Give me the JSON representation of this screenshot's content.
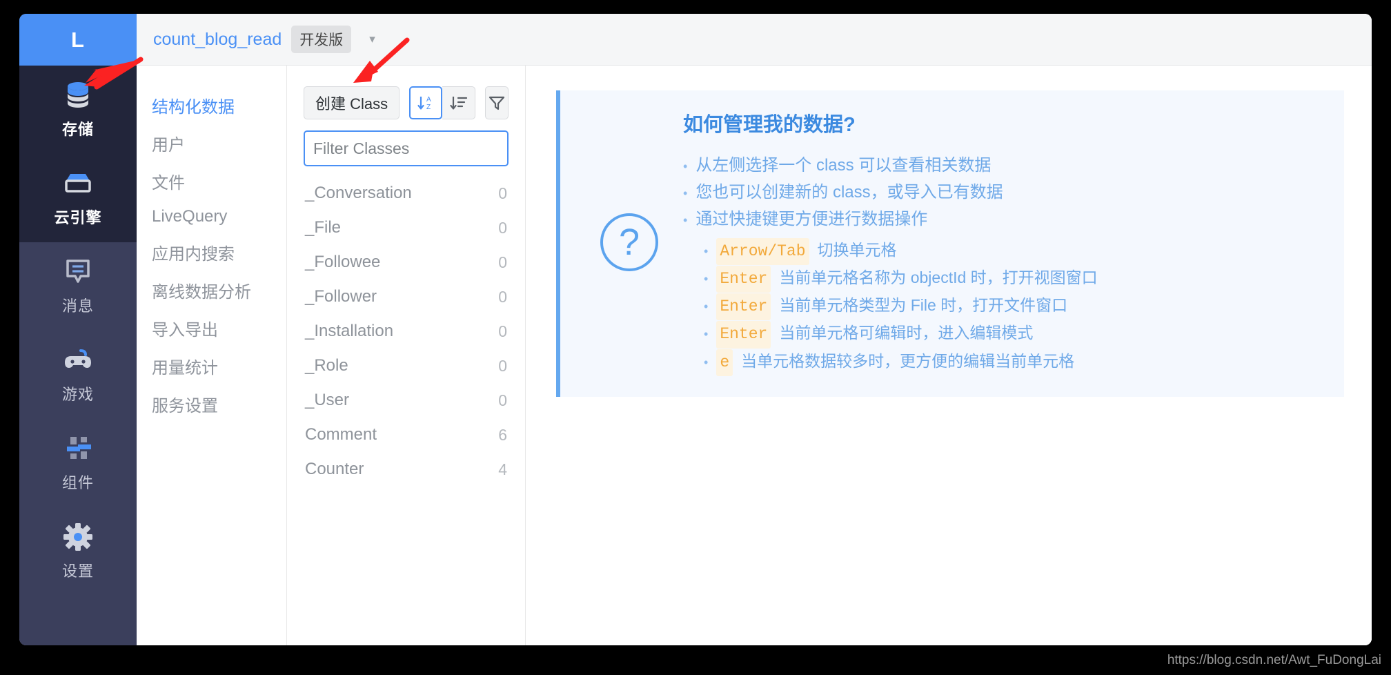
{
  "colors": {
    "accent": "#4a90f5",
    "rail_bg": "#3b3f5c",
    "rail_active_bg": "#22253a",
    "help_bg": "#f4f8fe",
    "help_text": "#6fa9e8",
    "kbd": "#f2a93b",
    "annotation": "#fb2222"
  },
  "rail": {
    "logo": "L",
    "items": [
      {
        "label": "存储",
        "icon": "database-icon",
        "active": true
      },
      {
        "label": "云引擎",
        "icon": "cloud-engine-icon",
        "active": true
      },
      {
        "label": "消息",
        "icon": "message-icon",
        "active": false
      },
      {
        "label": "游戏",
        "icon": "gamepad-icon",
        "active": false
      },
      {
        "label": "组件",
        "icon": "components-icon",
        "active": false
      },
      {
        "label": "设置",
        "icon": "gear-icon",
        "active": false
      }
    ]
  },
  "topbar": {
    "app_name": "count_blog_read",
    "env_badge": "开发版",
    "caret": "▾"
  },
  "subnav": {
    "items": [
      {
        "label": "结构化数据",
        "active": true
      },
      {
        "label": "用户",
        "active": false
      },
      {
        "label": "文件",
        "active": false
      },
      {
        "label": "LiveQuery",
        "active": false
      },
      {
        "label": "应用内搜索",
        "active": false
      },
      {
        "label": "离线数据分析",
        "active": false
      },
      {
        "label": "导入导出",
        "active": false
      },
      {
        "label": "用量统计",
        "active": false
      },
      {
        "label": "服务设置",
        "active": false
      }
    ]
  },
  "classpanel": {
    "create_button": "创建 Class",
    "sort_alpha_title": "按字母排序",
    "sort_list_title": "按顺序排序",
    "filter_title": "筛选",
    "filter_placeholder": "Filter Classes",
    "filter_value": "",
    "classes": [
      {
        "name": "_Conversation",
        "count": "0"
      },
      {
        "name": "_File",
        "count": "0"
      },
      {
        "name": "_Followee",
        "count": "0"
      },
      {
        "name": "_Follower",
        "count": "0"
      },
      {
        "name": "_Installation",
        "count": "0"
      },
      {
        "name": "_Role",
        "count": "0"
      },
      {
        "name": "_User",
        "count": "0"
      },
      {
        "name": "Comment",
        "count": "6"
      },
      {
        "name": "Counter",
        "count": "4"
      }
    ]
  },
  "help": {
    "icon": "question-mark-icon",
    "title": "如何管理我的数据?",
    "bullets": [
      "从左侧选择一个 class 可以查看相关数据",
      "您也可以创建新的 class，或导入已有数据",
      "通过快捷键更方便进行数据操作"
    ],
    "shortcuts": [
      {
        "key": "Arrow/Tab",
        "desc": "切换单元格"
      },
      {
        "key": "Enter",
        "desc": "当前单元格名称为 objectId 时，打开视图窗口"
      },
      {
        "key": "Enter",
        "desc": "当前单元格类型为 File 时，打开文件窗口"
      },
      {
        "key": "Enter",
        "desc": "当前单元格可编辑时，进入编辑模式"
      },
      {
        "key": "e",
        "desc": "当单元格数据较多时，更方便的编辑当前单元格"
      }
    ]
  },
  "watermark": "https://blog.csdn.net/Awt_FuDongLai"
}
